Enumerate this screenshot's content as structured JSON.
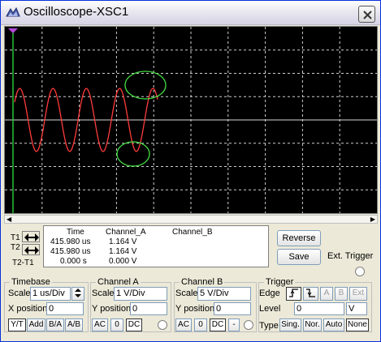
{
  "window": {
    "title": "Oscilloscope-XSC1"
  },
  "measurements": {
    "headers": {
      "time": "Time",
      "channel_a": "Channel_A",
      "channel_b": "Channel_B"
    },
    "rows": [
      {
        "label": "T1",
        "time": "415.980 us",
        "channel_a": "1.164 V"
      },
      {
        "label": "T2",
        "time": "415.980 us",
        "channel_a": "1.164 V"
      },
      {
        "label": "T2-T1",
        "time": "0.000 s",
        "channel_a": "0.000 V"
      }
    ]
  },
  "buttons": {
    "reverse": "Reverse",
    "save": "Save",
    "ext_trigger": "Ext. Trigger"
  },
  "timebase": {
    "title": "Timebase",
    "scale_label": "Scale",
    "scale_value": "1 us/Div",
    "xpos_label": "X position",
    "xpos_value": "0",
    "modes": [
      "Y/T",
      "Add",
      "B/A",
      "A/B"
    ],
    "active_mode": "Y/T"
  },
  "channel_a": {
    "title": "Channel A",
    "scale_label": "Scale",
    "scale_value": "1  V/Div",
    "ypos_label": "Y position",
    "ypos_value": "0",
    "coupling": [
      "AC",
      "0",
      "DC"
    ],
    "active_coupling": "DC"
  },
  "channel_b": {
    "title": "Channel B",
    "scale_label": "Scale",
    "scale_value": "5  V/Div",
    "ypos_label": "Y position",
    "ypos_value": "0",
    "coupling": [
      "AC",
      "0",
      "DC",
      "-"
    ],
    "active_coupling": "DC"
  },
  "trigger": {
    "title": "Trigger",
    "edge_label": "Edge",
    "edge_sources": [
      "A",
      "B",
      "Ext"
    ],
    "level_label": "Level",
    "level_value": "0",
    "level_unit": "V",
    "type_label": "Type",
    "types": [
      "Sing.",
      "Nor.",
      "Auto",
      "None"
    ],
    "active_type": "None"
  },
  "display": {
    "grid_divisions": {
      "x": 10,
      "y": 8
    },
    "trace_color": "#ff3b3b",
    "cursor_color": "#2ad03a",
    "annotation_color": "#43e043",
    "background": "#000000",
    "channel_a_volts_per_div": 1,
    "time_per_div_us": 1
  }
}
